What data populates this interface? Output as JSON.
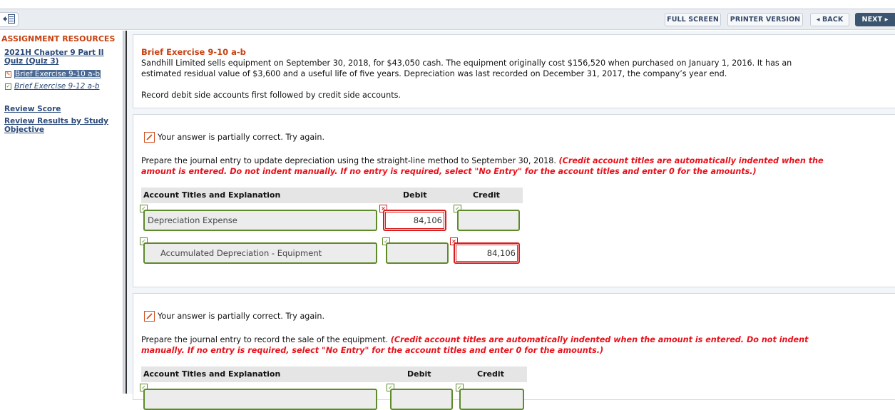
{
  "toolbar": {
    "collapse_icon": "collapse-sidebar-icon",
    "full_screen": "FULL SCREEN",
    "printer_version": "PRINTER VERSION",
    "back": "◂ BACK",
    "next": "NEXT ▸"
  },
  "sidebar": {
    "heading": "ASSIGNMENT RESOURCES",
    "quiz_link_line1": "2021H Chapter 9 Part II",
    "quiz_link_line2": "Quiz (Quiz 3)",
    "items": [
      {
        "label": "Brief Exercise 9-10 a-b",
        "status": "partial",
        "active": true
      },
      {
        "label": "Brief Exercise 9-12 a-b",
        "status": "correct",
        "active": false
      }
    ],
    "review_score": "Review Score",
    "review_results_line1": "Review Results by Study",
    "review_results_line2": "Objective"
  },
  "question": {
    "title": "Brief Exercise 9-10 a-b",
    "body_line1": "Sandhill Limited sells equipment on September 30, 2018, for $43,050 cash. The equipment originally cost $156,520 when purchased on January 1, 2016. It has an",
    "body_line2": "estimated residual value of $3,600 and a useful life of five years. Depreciation was last recorded on December 31, 2017, the company’s year end.",
    "instruction": "Record debit side accounts first followed by credit side accounts."
  },
  "part_a": {
    "status": "Your answer is partially correct.  Try again.",
    "prompt_plain": "Prepare the journal entry to update depreciation using the straight-line method to September 30, 2018. ",
    "prompt_red_line1": "(Credit account titles are automatically indented when the",
    "prompt_red_line2": "amount is entered. Do not indent manually. If no entry is required, select \"No Entry\" for the account titles and enter 0 for the amounts.)",
    "headers": {
      "account": "Account Titles and Explanation",
      "debit": "Debit",
      "credit": "Credit"
    },
    "rows": [
      {
        "account": "Depreciation Expense",
        "debit": "84,106",
        "credit": "",
        "account_ok": true,
        "debit_ok": false,
        "credit_ok": true
      },
      {
        "account": "Accumulated Depreciation - Equipment",
        "debit": "",
        "credit": "84,106",
        "account_ok": true,
        "debit_ok": true,
        "credit_ok": false
      }
    ]
  },
  "part_b": {
    "status": "Your answer is partially correct.  Try again.",
    "prompt_plain": "Prepare the journal entry to record the sale of the equipment. ",
    "prompt_red_line1": "(Credit account titles are automatically indented when the amount is entered. Do not indent",
    "prompt_red_line2": "manually. If no entry is required, select \"No Entry\" for the account titles and enter 0 for the amounts.)",
    "headers": {
      "account": "Account Titles and Explanation",
      "debit": "Debit",
      "credit": "Credit"
    }
  },
  "colors": {
    "accent_orange": "#c7400f",
    "link_blue": "#2b4a7a",
    "correct_green": "#5e8a2a",
    "wrong_red": "#d81e1e",
    "instruction_red": "#e8101a",
    "next_button": "#3b5570"
  }
}
